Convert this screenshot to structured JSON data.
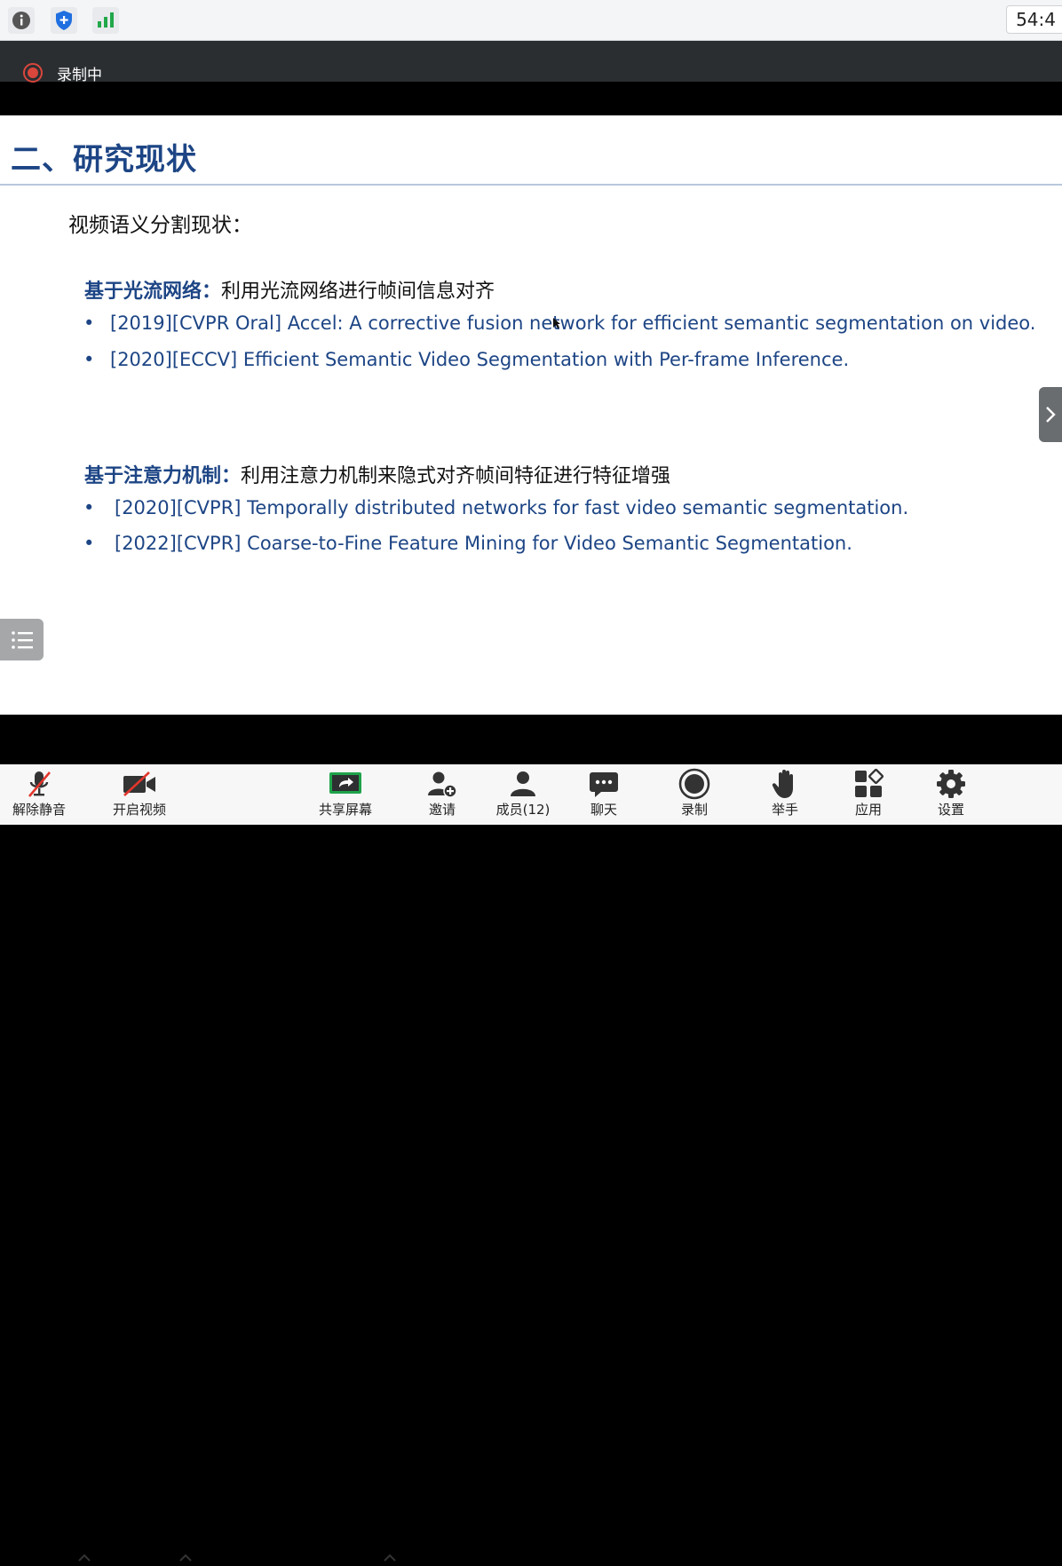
{
  "topbar": {
    "icons": [
      "info-icon",
      "shield-icon",
      "signal-icon"
    ],
    "timer": "54:4"
  },
  "recording": {
    "label": "录制中",
    "color": "#d9463c"
  },
  "slide": {
    "title": "二、研究现状",
    "subhead": "视频语义分割现状：",
    "sections": [
      {
        "head_strong": "基于光流网络：",
        "head_rest": "利用光流网络进行帧间信息对齐",
        "items": [
          "[2019][CVPR Oral] Accel: A corrective fusion network for efficient semantic segmentation on video.",
          "[2020][ECCV] Efficient Semantic Video Segmentation with Per-frame Inference."
        ]
      },
      {
        "head_strong": "基于注意力机制：",
        "head_rest": "利用注意力机制来隐式对齐帧间特征进行特征增强",
        "items": [
          "[2020][CVPR] Temporally distributed networks for fast video semantic segmentation.",
          "[2022][CVPR] Coarse-to-Fine Feature Mining for Video Semantic Segmentation."
        ]
      }
    ],
    "bullet_char": "•",
    "accent": "#1d4585"
  },
  "toolbar": {
    "unmute": "解除静音",
    "start_video": "开启视频",
    "share_screen": "共享屏幕",
    "invite": "邀请",
    "members": "成员(12)",
    "chat": "聊天",
    "record": "录制",
    "raise_hand": "举手",
    "apps": "应用",
    "settings": "设置"
  }
}
